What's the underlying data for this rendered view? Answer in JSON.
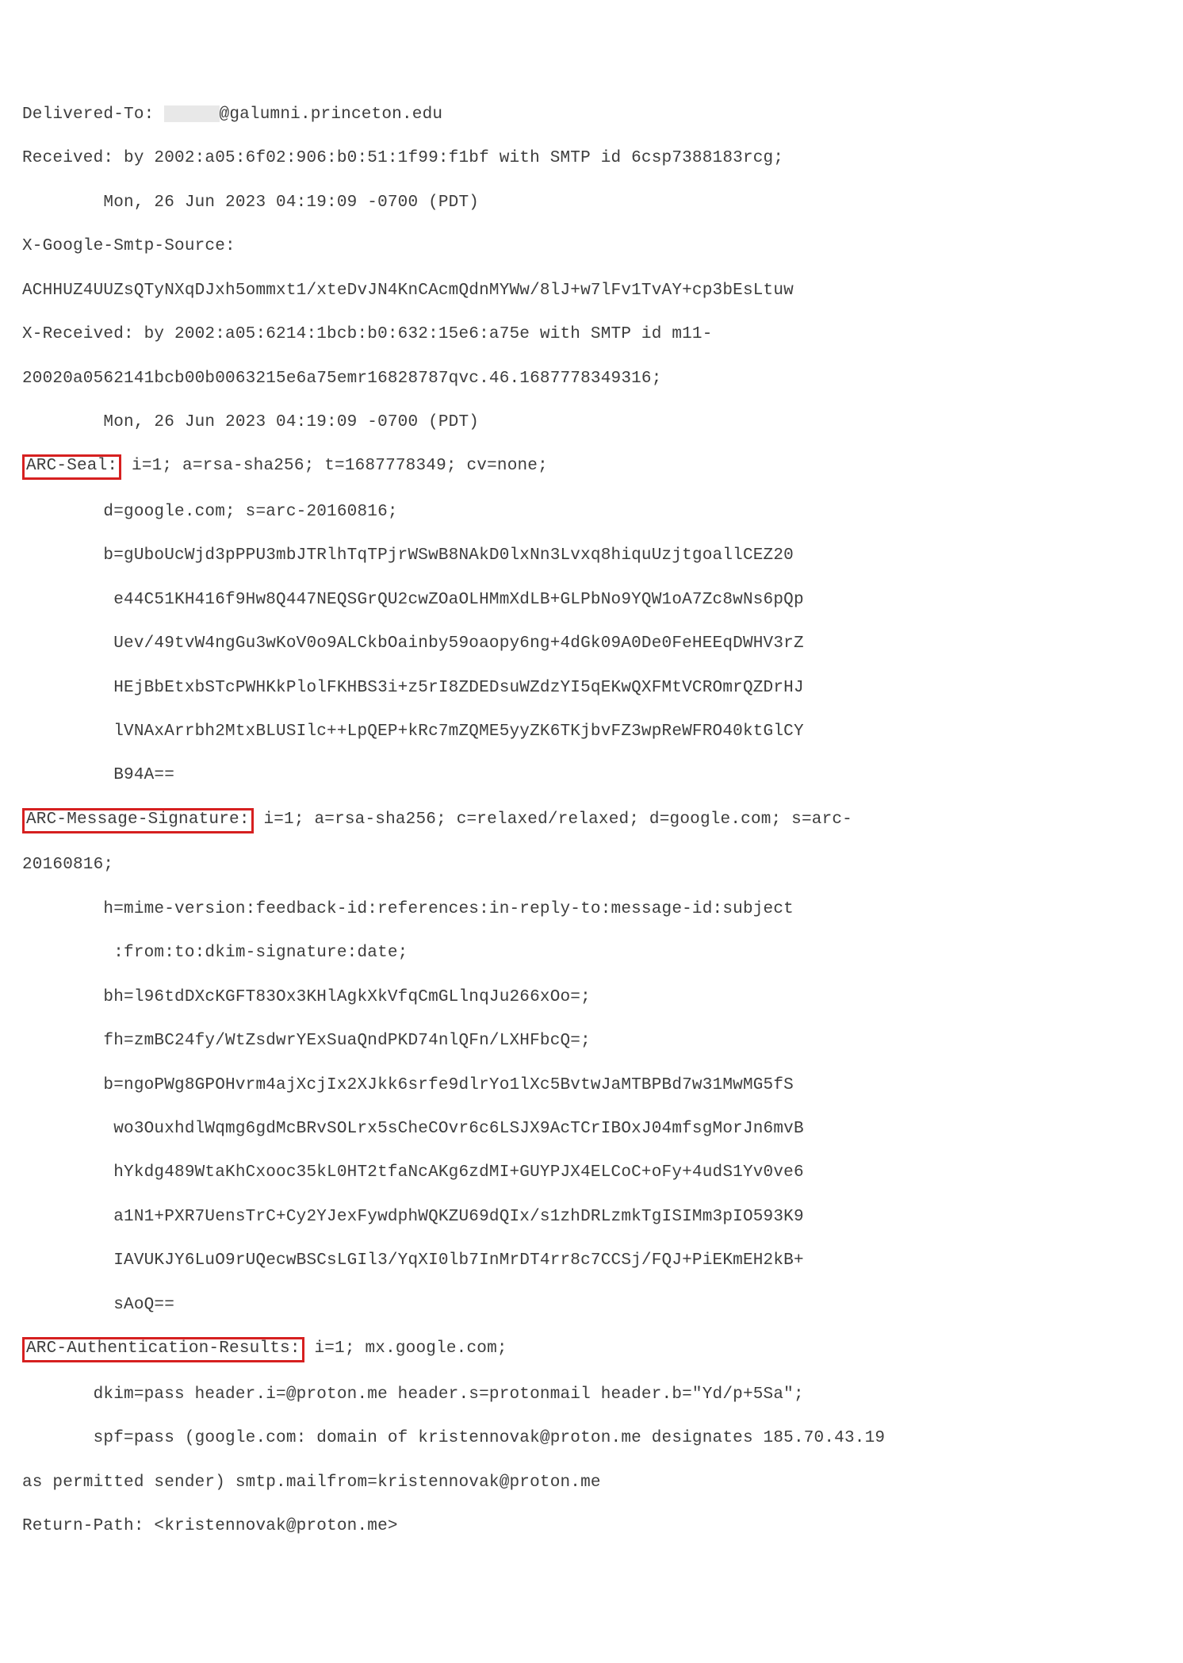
{
  "l01a": "Delivered-To: ",
  "l01b": "@galumni.princeton.edu",
  "l02": "Received: by 2002:a05:6f02:906:b0:51:1f99:f1bf with SMTP id 6csp7388183rcg;",
  "l03": "        Mon, 26 Jun 2023 04:19:09 -0700 (PDT)",
  "l04": "X-Google-Smtp-Source:",
  "l05": "ACHHUZ4UUZsQTyNXqDJxh5ommxt1/xteDvJN4KnCAcmQdnMYWw/8lJ+w7lFv1TvAY+cp3bEsLtuw",
  "l06": "X-Received: by 2002:a05:6214:1bcb:b0:632:15e6:a75e with SMTP id m11-",
  "l07": "20020a0562141bcb00b0063215e6a75emr16828787qvc.46.1687778349316;",
  "l08": "        Mon, 26 Jun 2023 04:19:09 -0700 (PDT)",
  "l09h": "ARC-Seal:",
  "l09r": " i=1; a=rsa-sha256; t=1687778349; cv=none;",
  "l10": "        d=google.com; s=arc-20160816;",
  "l11": "        b=gUboUcWjd3pPPU3mbJTRlhTqTPjrWSwB8NAkD0lxNn3Lvxq8hiquUzjtgoallCEZ20",
  "l12": "         e44C51KH416f9Hw8Q447NEQSGrQU2cwZOaOLHMmXdLB+GLPbNo9YQW1oA7Zc8wNs6pQp",
  "l13": "         Uev/49tvW4ngGu3wKoV0o9ALCkbOainby59oaopy6ng+4dGk09A0De0FeHEEqDWHV3rZ",
  "l14": "         HEjBbEtxbSTcPWHKkPlolFKHBS3i+z5rI8ZDEDsuWZdzYI5qEKwQXFMtVCROmrQZDrHJ",
  "l15": "         lVNAxArrbh2MtxBLUSIlc++LpQEP+kRc7mZQME5yyZK6TKjbvFZ3wpReWFRO40ktGlCY",
  "l16": "         B94A==",
  "l17h": "ARC-Message-Signature:",
  "l17r": " i=1; a=rsa-sha256; c=relaxed/relaxed; d=google.com; s=arc-",
  "l18": "20160816;",
  "l19": "        h=mime-version:feedback-id:references:in-reply-to:message-id:subject",
  "l20": "         :from:to:dkim-signature:date;",
  "l21": "        bh=l96tdDXcKGFT83Ox3KHlAgkXkVfqCmGLlnqJu266xOo=;",
  "l22": "        fh=zmBC24fy/WtZsdwrYExSuaQndPKD74nlQFn/LXHFbcQ=;",
  "l23": "        b=ngoPWg8GPOHvrm4ajXcjIx2XJkk6srfe9dlrYo1lXc5BvtwJaMTBPBd7w31MwMG5fS",
  "l24": "         wo3OuxhdlWqmg6gdMcBRvSOLrx5sCheCOvr6c6LSJX9AcTCrIBOxJ04mfsgMorJn6mvB",
  "l25": "         hYkdg489WtaKhCxooc35kL0HT2tfaNcAKg6zdMI+GUYPJX4ELCoC+oFy+4udS1Yv0ve6",
  "l26": "         a1N1+PXR7UensTrC+Cy2YJexFywdphWQKZU69dQIx/s1zhDRLzmkTgISIMm3pIO593K9",
  "l27": "         IAVUKJY6LuO9rUQecwBSCsLGIl3/YqXI0lb7InMrDT4rr8c7CCSj/FQJ+PiEKmEH2kB+",
  "l28": "         sAoQ==",
  "l29h": "ARC-Authentication-Results:",
  "l29r": " i=1; mx.google.com;",
  "l30": "       dkim=pass header.i=@proton.me header.s=protonmail header.b=\"Yd/p+5Sa\";",
  "l31": "       spf=pass (google.com: domain of kristennovak@proton.me designates 185.70.43.19",
  "l32": "as permitted sender) smtp.mailfrom=kristennovak@proton.me",
  "l33": "Return-Path: <kristennovak@proton.me>"
}
